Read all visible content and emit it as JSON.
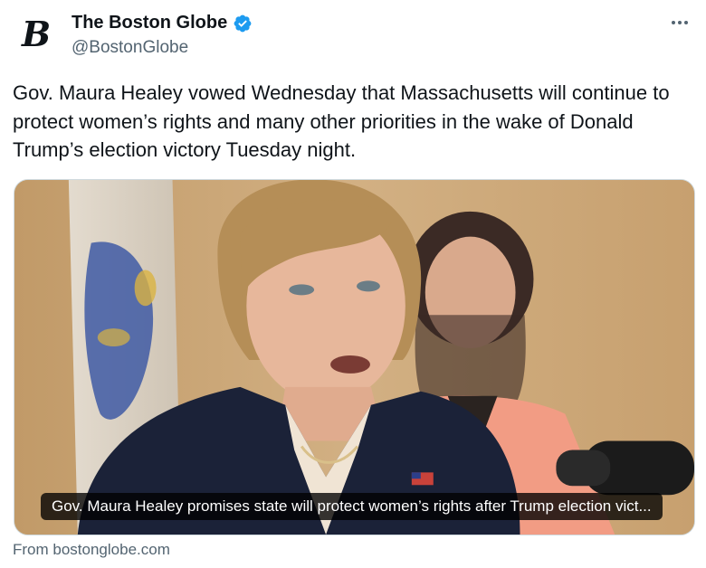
{
  "author": {
    "display_name": "The Boston Globe",
    "handle": "@BostonGlobe",
    "logo_glyph": "B",
    "verified": true,
    "verified_color": "#1d9bf0"
  },
  "more_icon": "more-horizontal-icon",
  "tweet": {
    "text": "Gov. Maura Healey vowed Wednesday that Massachusetts will continue to protect women’s rights and many other priorities in the wake of Donald Trump’s election victory Tuesday night."
  },
  "link_card": {
    "caption": "Gov. Maura Healey promises state will protect women’s rights after Trump election vict...",
    "source": "From bostonglobe.com"
  }
}
